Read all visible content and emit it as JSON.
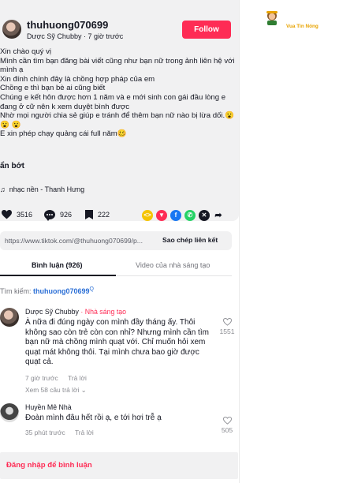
{
  "post": {
    "username": "thuhuong070699",
    "subline": "Dược Sỹ Chubby · 7 giờ trước",
    "follow_label": "Follow",
    "caption": "Xin chào quý vị\nMình cần tìm bạn đăng bài viết cũng như bạn nữ trong ảnh liên hệ với mình ạ\nXin đính chính đây là chồng hợp pháp của em\nChồng e thì bạn bè ai cũng biết\nChúng e kết hôn được hơn 1 năm và e mới sinh con gái đầu lòng e đang ở cữ nên k xem duyệt bình được\nNhờ mọi người chia sẻ giúp e tránh để thêm bạn nữ nào bị lừa dối.😮 😮 😮\nE xin phép chạy quảng cái full năm🥴",
    "less_label": "ẩn bớt",
    "music_icon": "music-note-icon",
    "music": "nhạc nền - Thanh Hưng"
  },
  "stats": {
    "likes": "3516",
    "comments": "926",
    "saves": "222"
  },
  "share_icons": [
    {
      "name": "embed-icon",
      "color": "#f5c400"
    },
    {
      "name": "pin-icon",
      "color": "#fe2c55"
    },
    {
      "name": "facebook-icon",
      "color": "#1877f2"
    },
    {
      "name": "whatsapp-icon",
      "color": "#25d366"
    },
    {
      "name": "x-icon",
      "color": "#161823"
    },
    {
      "name": "arrow-share-icon",
      "color": "#161823"
    }
  ],
  "link": {
    "url": "https://www.tiktok.com/@thuhuong070699/p...",
    "copy_label": "Sao chép liên kết"
  },
  "tabs": {
    "comments": "Bình luận (926)",
    "creator_videos": "Video của nhà sáng tạo"
  },
  "search": {
    "label": "Tìm kiếm:",
    "term": "thuhuong070699",
    "icon": "search-icon"
  },
  "comments": [
    {
      "name": "Dược Sỹ Chubby",
      "badge": "· Nhà sáng tạo",
      "text": "À nữa đi đúng ngày con mình đầy tháng ấy. Thôi không sao còn trẻ còn con nhỉ? Nhưng mình cần tìm bạn nữ mà chồng mình quạt với. Chỉ muốn hỏi xem quạt mát không thôi. Tại mình chưa bao giờ được quạt cả.",
      "time": "7 giờ trước",
      "reply": "Trả lời",
      "more": "Xem 58 câu trả lời ⌄",
      "likes": "1551"
    },
    {
      "name": "Huyền Mê Nhà",
      "badge": "",
      "text": "Đoàn mình đâu hết rồi ạ, e tới hơi trễ ạ",
      "time": "35 phút trước",
      "reply": "Trả lời",
      "likes": "505"
    }
  ],
  "login_label": "Đăng nhập để bình luận",
  "brand": {
    "name": "Vua Tin Nóng",
    "color": "#e8a300",
    "accent": "#fe2c55"
  }
}
